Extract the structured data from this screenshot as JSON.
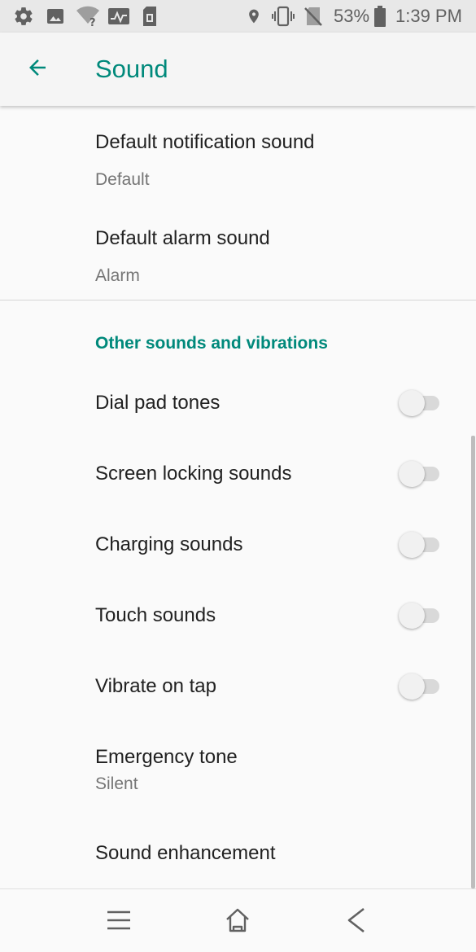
{
  "status_bar": {
    "battery_percent": "53%",
    "time": "1:39 PM",
    "icons": [
      "settings-icon",
      "image-icon",
      "wifi-unknown-icon",
      "activity-icon",
      "sim-icon",
      "location-icon",
      "vibrate-icon",
      "no-sim-icon",
      "battery-icon"
    ]
  },
  "app_bar": {
    "title": "Sound",
    "back_icon": "arrow-left-icon"
  },
  "settings": {
    "default_notification": {
      "title": "Default notification sound",
      "value": "Default"
    },
    "default_alarm": {
      "title": "Default alarm sound",
      "value": "Alarm"
    },
    "section_header": "Other sounds and vibrations",
    "dial_pad": {
      "title": "Dial pad tones",
      "enabled": false
    },
    "screen_locking": {
      "title": "Screen locking sounds",
      "enabled": false
    },
    "charging": {
      "title": "Charging sounds",
      "enabled": false
    },
    "touch": {
      "title": "Touch sounds",
      "enabled": false
    },
    "vibrate_on_tap": {
      "title": "Vibrate on tap",
      "enabled": false
    },
    "emergency_tone": {
      "title": "Emergency tone",
      "value": "Silent"
    },
    "sound_enhancement": {
      "title": "Sound enhancement"
    }
  },
  "nav_bar": {
    "icons": [
      "menu-icon",
      "home-icon",
      "back-icon"
    ]
  },
  "colors": {
    "accent": "#00897b",
    "status_bar_bg": "#e8e8e8",
    "app_bar_bg": "#f5f5f5",
    "page_bg": "#fafafa"
  }
}
